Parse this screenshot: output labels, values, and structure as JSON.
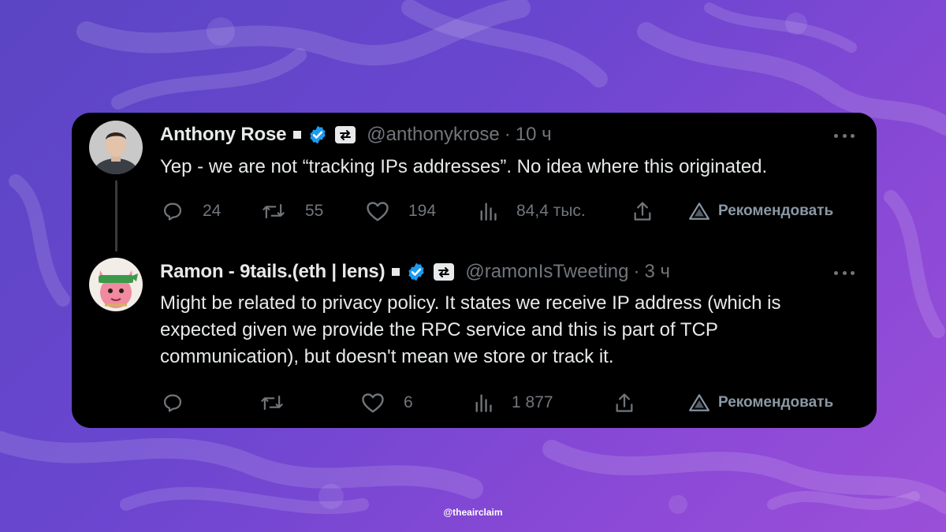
{
  "theme": {
    "accent": "#1d9bf0",
    "card_bg": "#000000",
    "text_primary": "#e7e9ea",
    "text_secondary": "#71767b",
    "background_gradient": [
      "#5b45c4",
      "#9b4fd8"
    ]
  },
  "tweets": [
    {
      "author_name": "Anthony Rose",
      "handle": "@anthonykrose",
      "separator": "·",
      "time": "10 ч",
      "verified": true,
      "text": "Yep - we are not “tracking IPs addresses”. No idea where this originated.",
      "actions": {
        "reply_count": "24",
        "retweet_count": "55",
        "like_count": "194",
        "views_count": "84,4 тыс.",
        "recommend_label": "Рекомендовать"
      },
      "icons": [
        "reply-icon",
        "retweet-icon",
        "like-icon",
        "views-icon",
        "share-icon",
        "recommend-icon"
      ]
    },
    {
      "author_name": "Ramon - 9tails.(eth | lens)",
      "handle": "@ramonIsTweeting",
      "separator": "·",
      "time": "3 ч",
      "verified": true,
      "text": "Might be related to privacy policy. It states we receive IP address (which is expected given we provide the RPC service and this is part of TCP communication), but doesn't mean we store or track it.",
      "actions": {
        "reply_count": "",
        "retweet_count": "",
        "like_count": "6",
        "views_count": "1 877",
        "recommend_label": "Рекомендовать"
      },
      "icons": [
        "reply-icon",
        "retweet-icon",
        "like-icon",
        "views-icon",
        "share-icon",
        "recommend-icon"
      ]
    }
  ],
  "footer": {
    "watermark": "@theairclaim"
  }
}
